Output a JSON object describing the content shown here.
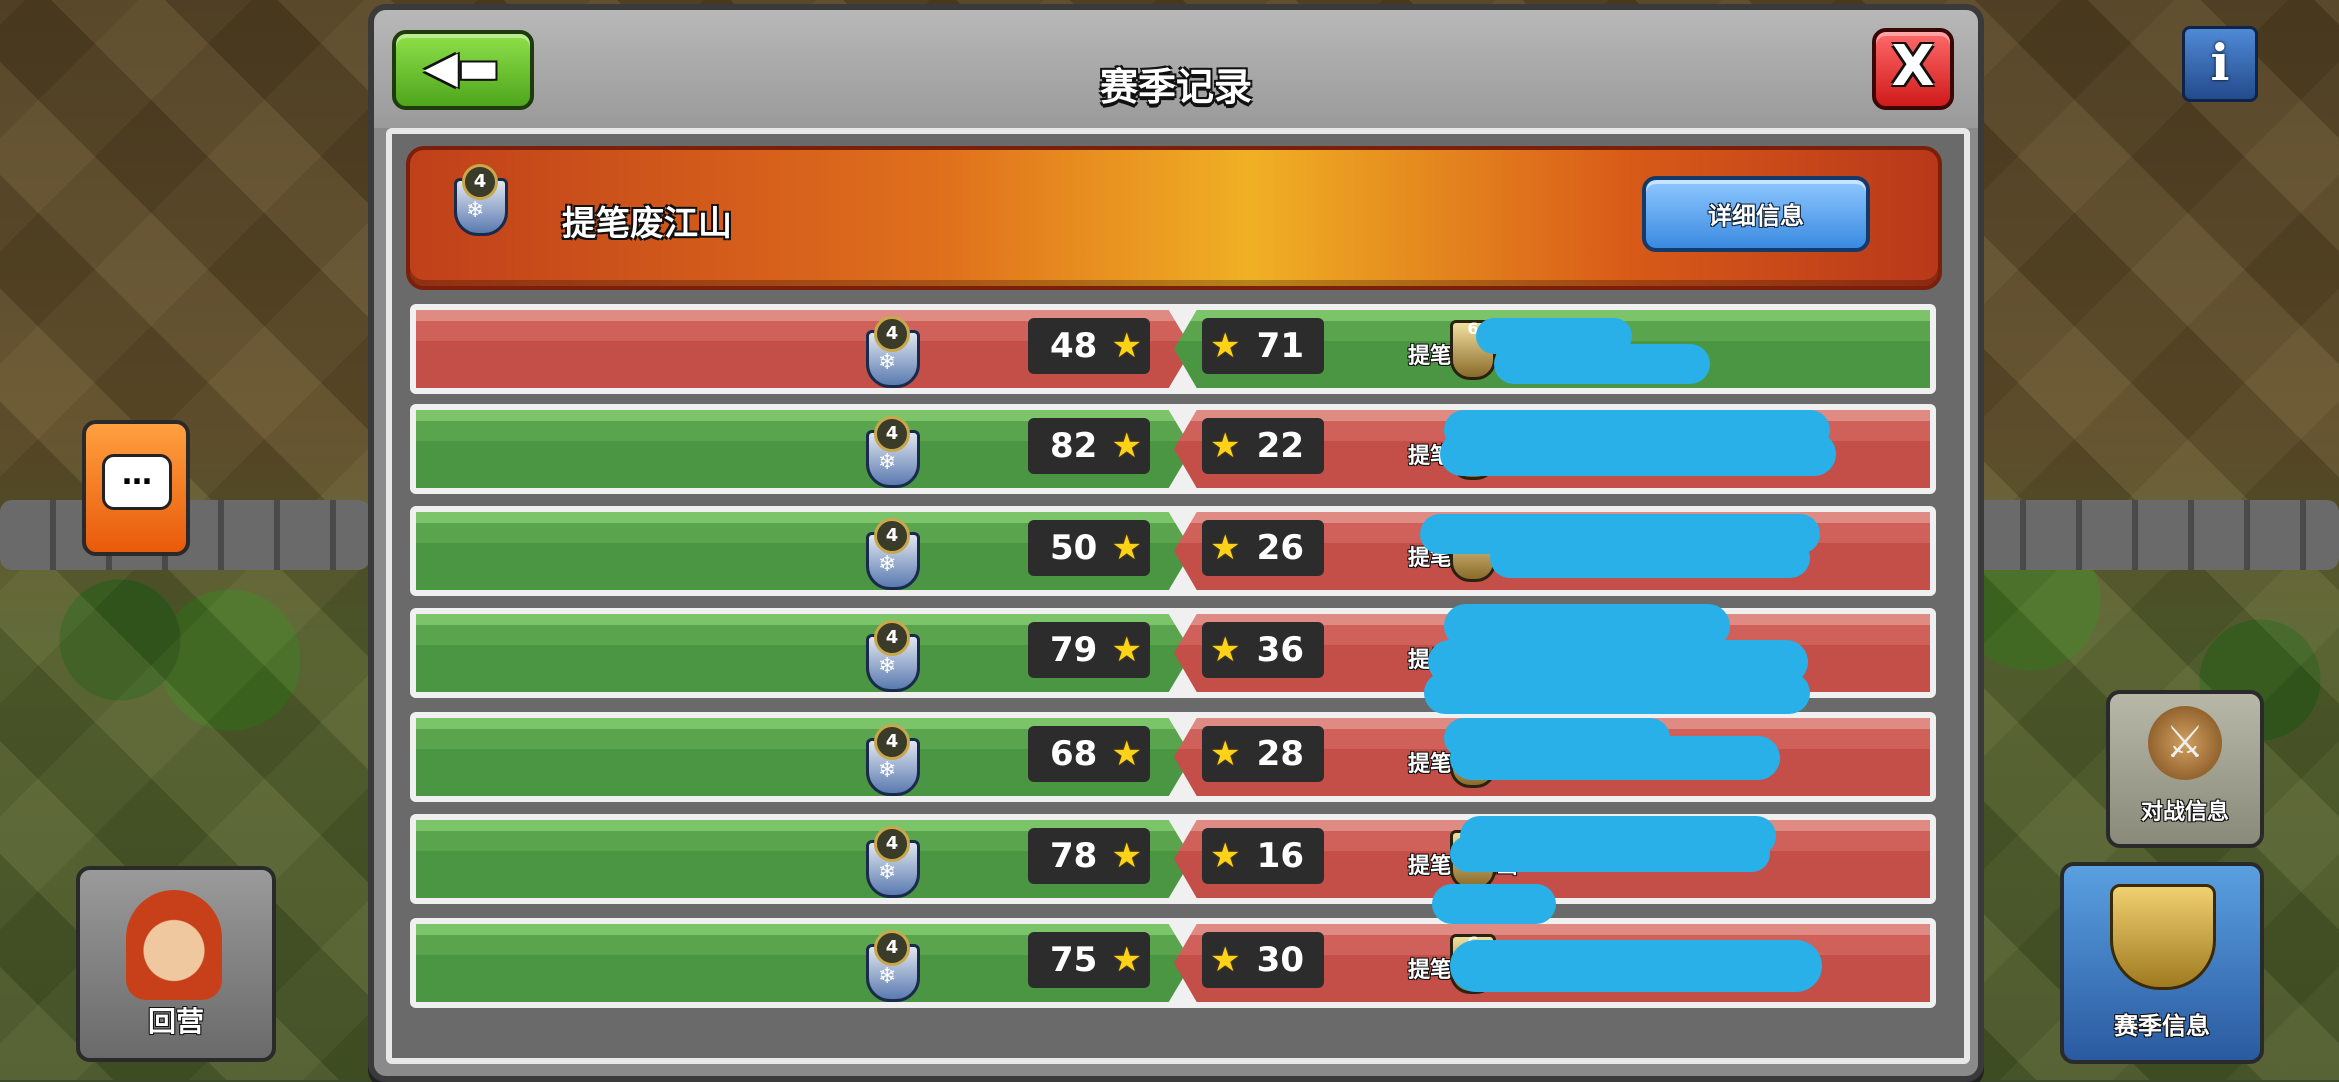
{
  "window": {
    "title": "赛季记录"
  },
  "header": {
    "player_name": "提笔废江山",
    "town_hall_level": "4",
    "detail_button": "详细信息"
  },
  "rows": [
    {
      "my_name": "提笔废江山",
      "my_th": "4",
      "my_stars": "48",
      "opp_stars": "71",
      "opp_th": "6",
      "result": "loss"
    },
    {
      "my_name": "提笔废江山",
      "my_th": "4",
      "my_stars": "82",
      "opp_stars": "22",
      "opp_th": "",
      "result": "win"
    },
    {
      "my_name": "提笔废江山",
      "my_th": "4",
      "my_stars": "50",
      "opp_stars": "26",
      "opp_th": "",
      "result": "win"
    },
    {
      "my_name": "提笔废江山",
      "my_th": "4",
      "my_stars": "79",
      "opp_stars": "36",
      "opp_th": "",
      "result": "win"
    },
    {
      "my_name": "提笔废江山",
      "my_th": "4",
      "my_stars": "68",
      "opp_stars": "28",
      "opp_th": "",
      "result": "win"
    },
    {
      "my_name": "提笔废江山",
      "my_th": "4",
      "my_stars": "78",
      "opp_stars": "16",
      "opp_th": "",
      "result": "win"
    },
    {
      "my_name": "提笔废江山",
      "my_th": "4",
      "my_stars": "75",
      "opp_stars": "30",
      "opp_th": "6",
      "result": "win"
    }
  ],
  "sidebar": {
    "battle_info": "对战信息",
    "season_info": "赛季信息",
    "return_home": "回营"
  },
  "icons": {
    "back": "arrow-left-icon",
    "close": "close-icon",
    "info": "info-icon",
    "chat": "chat-icon",
    "star": "star-icon"
  },
  "colors": {
    "win": "#5aa44e",
    "loss": "#c44e48",
    "star": "#ffd21a",
    "detail_button": "#3a8ae0"
  }
}
